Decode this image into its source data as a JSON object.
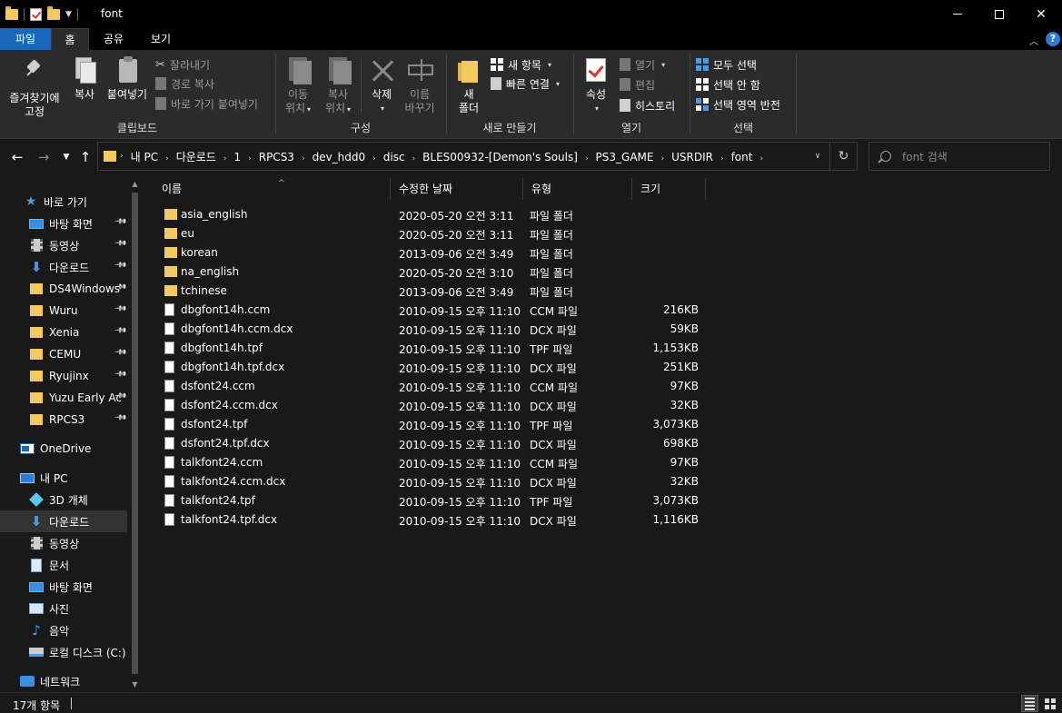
{
  "window": {
    "title": "font",
    "minimize_label": "",
    "maximize_label": "",
    "close_label": "✕"
  },
  "tabs": {
    "file": "파일",
    "home": "홈",
    "share": "공유",
    "view": "보기"
  },
  "ribbon": {
    "clipboard": {
      "title": "클립보드",
      "pin_line1": "즐겨찾기에",
      "pin_line2": "고정",
      "copy": "복사",
      "paste": "붙여넣기",
      "cut": "잘라내기",
      "copy_path": "경로 복사",
      "paste_shortcut": "바로 가기 붙여넣기"
    },
    "organize": {
      "title": "구성",
      "move_line1": "이동",
      "move_line2": "위치",
      "copyto_line1": "복사",
      "copyto_line2": "위치",
      "delete": "삭제",
      "rename_line1": "이름",
      "rename_line2": "바꾸기"
    },
    "new": {
      "title": "새로 만들기",
      "new_folder_line1": "새",
      "new_folder_line2": "폴더",
      "new_item": "새 항목",
      "easy_access": "빠른 연결"
    },
    "open": {
      "title": "열기",
      "properties": "속성",
      "open": "열기",
      "edit": "편집",
      "history": "히스토리"
    },
    "select": {
      "title": "선택",
      "select_all": "모두 선택",
      "select_none": "선택 안 함",
      "invert": "선택 영역 반전"
    }
  },
  "address": {
    "breadcrumbs": [
      "내 PC",
      "다운로드",
      "1",
      "RPCS3",
      "dev_hdd0",
      "disc",
      "BLES00932-[Demon's Souls]",
      "PS3_GAME",
      "USRDIR",
      "font"
    ],
    "search_placeholder": "font 검색"
  },
  "nav": {
    "quick_access": "바로 가기",
    "quick_items": [
      {
        "label": "바탕 화면",
        "icon": "desktop-icon"
      },
      {
        "label": "동영상",
        "icon": "video-icon"
      },
      {
        "label": "다운로드",
        "icon": "download-icon"
      },
      {
        "label": "DS4Windows",
        "icon": "folder-icon"
      },
      {
        "label": "Wuru",
        "icon": "folder-icon"
      },
      {
        "label": "Xenia",
        "icon": "folder-icon"
      },
      {
        "label": "CEMU",
        "icon": "folder-icon"
      },
      {
        "label": "Ryujinx",
        "icon": "folder-icon"
      },
      {
        "label": "Yuzu Early Ac",
        "icon": "folder-icon"
      },
      {
        "label": "RPCS3",
        "icon": "folder-icon"
      }
    ],
    "onedrive": "OneDrive",
    "this_pc": "내 PC",
    "pc_items": [
      {
        "label": "3D 개체",
        "icon": "3d-objects-icon"
      },
      {
        "label": "다운로드",
        "icon": "download-icon"
      },
      {
        "label": "동영상",
        "icon": "video-icon"
      },
      {
        "label": "문서",
        "icon": "documents-icon"
      },
      {
        "label": "바탕 화면",
        "icon": "desktop-icon"
      },
      {
        "label": "사진",
        "icon": "pictures-icon"
      },
      {
        "label": "음악",
        "icon": "music-icon"
      },
      {
        "label": "로컬 디스크 (C:)",
        "icon": "drive-icon"
      }
    ],
    "network": "네트워크"
  },
  "columns": {
    "name": "이름",
    "date": "수정한 날짜",
    "type": "유형",
    "size": "크기"
  },
  "files": [
    {
      "name": "asia_english",
      "date": "2020-05-20 오전 3:11",
      "type": "파일 폴더",
      "size": "",
      "kind": "folder"
    },
    {
      "name": "eu",
      "date": "2020-05-20 오전 3:11",
      "type": "파일 폴더",
      "size": "",
      "kind": "folder"
    },
    {
      "name": "korean",
      "date": "2013-09-06 오전 3:49",
      "type": "파일 폴더",
      "size": "",
      "kind": "folder"
    },
    {
      "name": "na_english",
      "date": "2020-05-20 오전 3:10",
      "type": "파일 폴더",
      "size": "",
      "kind": "folder"
    },
    {
      "name": "tchinese",
      "date": "2013-09-06 오전 3:49",
      "type": "파일 폴더",
      "size": "",
      "kind": "folder"
    },
    {
      "name": "dbgfont14h.ccm",
      "date": "2010-09-15 오후 11:10",
      "type": "CCM 파일",
      "size": "216KB",
      "kind": "file"
    },
    {
      "name": "dbgfont14h.ccm.dcx",
      "date": "2010-09-15 오후 11:10",
      "type": "DCX 파일",
      "size": "59KB",
      "kind": "file"
    },
    {
      "name": "dbgfont14h.tpf",
      "date": "2010-09-15 오후 11:10",
      "type": "TPF 파일",
      "size": "1,153KB",
      "kind": "file"
    },
    {
      "name": "dbgfont14h.tpf.dcx",
      "date": "2010-09-15 오후 11:10",
      "type": "DCX 파일",
      "size": "251KB",
      "kind": "file"
    },
    {
      "name": "dsfont24.ccm",
      "date": "2010-09-15 오후 11:10",
      "type": "CCM 파일",
      "size": "97KB",
      "kind": "file"
    },
    {
      "name": "dsfont24.ccm.dcx",
      "date": "2010-09-15 오후 11:10",
      "type": "DCX 파일",
      "size": "32KB",
      "kind": "file"
    },
    {
      "name": "dsfont24.tpf",
      "date": "2010-09-15 오후 11:10",
      "type": "TPF 파일",
      "size": "3,073KB",
      "kind": "file"
    },
    {
      "name": "dsfont24.tpf.dcx",
      "date": "2010-09-15 오후 11:10",
      "type": "DCX 파일",
      "size": "698KB",
      "kind": "file"
    },
    {
      "name": "talkfont24.ccm",
      "date": "2010-09-15 오후 11:10",
      "type": "CCM 파일",
      "size": "97KB",
      "kind": "file"
    },
    {
      "name": "talkfont24.ccm.dcx",
      "date": "2010-09-15 오후 11:10",
      "type": "DCX 파일",
      "size": "32KB",
      "kind": "file"
    },
    {
      "name": "talkfont24.tpf",
      "date": "2010-09-15 오후 11:10",
      "type": "TPF 파일",
      "size": "3,073KB",
      "kind": "file"
    },
    {
      "name": "talkfont24.tpf.dcx",
      "date": "2010-09-15 오후 11:10",
      "type": "DCX 파일",
      "size": "1,116KB",
      "kind": "file"
    }
  ],
  "status": {
    "item_count": "17개 항목"
  },
  "colors": {
    "accent": "#1a66b8",
    "folder": "#f4c95d",
    "background": "#191919",
    "ribbon": "#2b2b2b"
  }
}
